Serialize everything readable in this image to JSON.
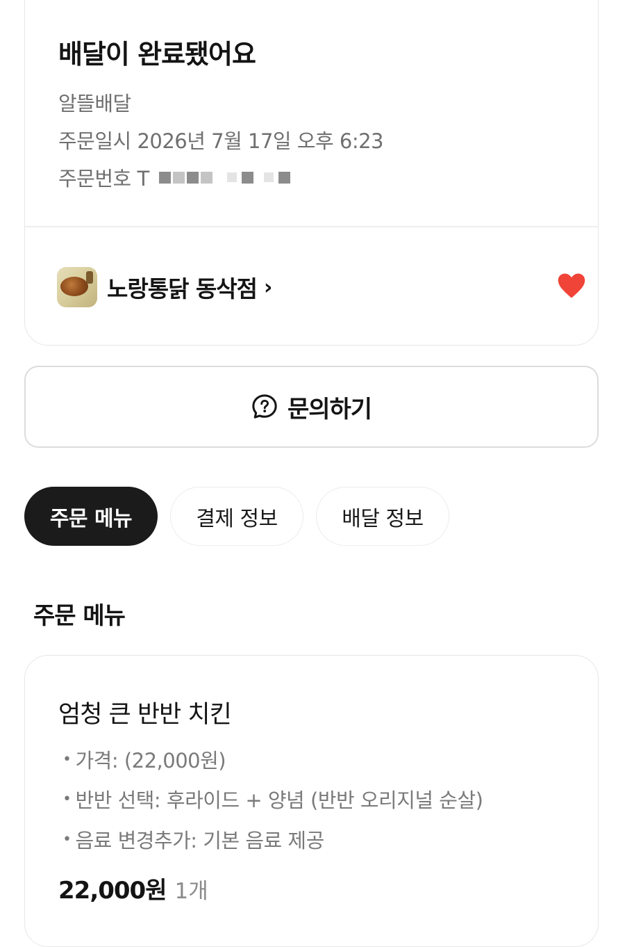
{
  "status": {
    "title": "배달이 완료됐어요",
    "delivery_type": "알뜰배달",
    "order_date": "주문일시 2026년 7월 17일 오후 6:23",
    "order_number_label": "주문번호 T"
  },
  "store": {
    "name": "노랑통닭 동삭점",
    "favorite": true,
    "heart_color": "#f04438"
  },
  "inquiry": {
    "label": "문의하기"
  },
  "tabs": [
    {
      "label": "주문 메뉴",
      "active": true
    },
    {
      "label": "결제 정보",
      "active": false
    },
    {
      "label": "배달 정보",
      "active": false
    }
  ],
  "order_menu": {
    "section_title": "주문 메뉴",
    "item": {
      "name": "엄청 큰 반반 치킨",
      "options": [
        "가격:  (22,000원)",
        "반반 선택: 후라이드 + 양념 (반반 오리지널 순살)",
        "음료 변경추가: 기본 음료 제공"
      ],
      "price": "22,000원",
      "quantity": "1개"
    }
  }
}
